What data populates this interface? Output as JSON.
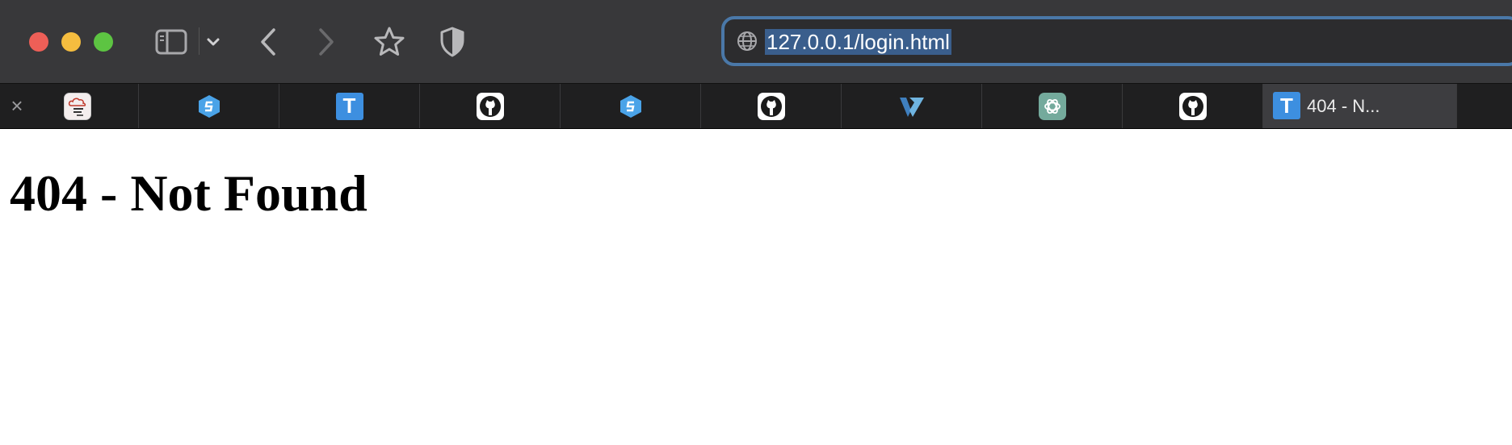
{
  "window": {
    "controls": [
      "close",
      "minimize",
      "maximize"
    ],
    "traffic_colors": {
      "close": "#ee5f57",
      "minimize": "#f5bd3f",
      "maximize": "#5dc442"
    }
  },
  "toolbar": {
    "icons": [
      "sidebar-icon",
      "chevron-down-icon",
      "back-icon",
      "forward-icon",
      "star-icon",
      "shield-icon"
    ]
  },
  "address_bar": {
    "url": "127.0.0.1/login.html",
    "icon": "globe-icon",
    "accent": "#4a78a8"
  },
  "tabs": [
    {
      "favicon": "cloud-weather-icon",
      "title": "",
      "active": false
    },
    {
      "favicon": "hex-s-icon",
      "title": "",
      "active": false
    },
    {
      "favicon": "t-icon",
      "title": "",
      "active": false
    },
    {
      "favicon": "github-icon",
      "title": "",
      "active": false
    },
    {
      "favicon": "hex-s-icon",
      "title": "",
      "active": false
    },
    {
      "favicon": "github-icon",
      "title": "",
      "active": false
    },
    {
      "favicon": "v-icon",
      "title": "",
      "active": false
    },
    {
      "favicon": "chatgpt-icon",
      "title": "",
      "active": false
    },
    {
      "favicon": "github-icon",
      "title": "",
      "active": false
    },
    {
      "favicon": "t-icon",
      "title": "404 - N...",
      "active": true
    }
  ],
  "page": {
    "heading": "404 - Not Found"
  }
}
